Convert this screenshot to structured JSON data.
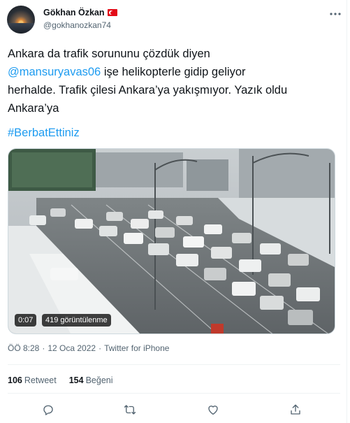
{
  "author": {
    "display_name": "Gökhan Özkan",
    "handle": "@gokhanozkan74"
  },
  "tweet": {
    "line1": "Ankara da trafik sorununu çözdük diyen",
    "mention": "@mansuryavas06",
    "line2_rest": " işe helikopterle gidip geliyor",
    "line3": "herhalde. Trafik çilesi Ankara’ya yakışmıyor. Yazık oldu",
    "line4": "Ankara’ya",
    "hashtag": "#BerbatEttiniz"
  },
  "video": {
    "duration": "0:07",
    "views": "419 görüntülenme"
  },
  "meta": {
    "time": "ÖÖ 8:28",
    "separator1": "·",
    "date": "12 Oca 2022",
    "separator2": "·",
    "source": "Twitter for iPhone"
  },
  "stats": {
    "retweets_count": "106",
    "retweets_label": "Retweet",
    "likes_count": "154",
    "likes_label": "Beğeni"
  },
  "icons": {
    "more": "more-horizontal-icon",
    "reply": "reply-icon",
    "retweet": "retweet-icon",
    "like": "heart-icon",
    "share": "share-icon"
  },
  "colors": {
    "link": "#1d9bf0",
    "secondary_text": "#536471",
    "action_icon": "#536471"
  }
}
